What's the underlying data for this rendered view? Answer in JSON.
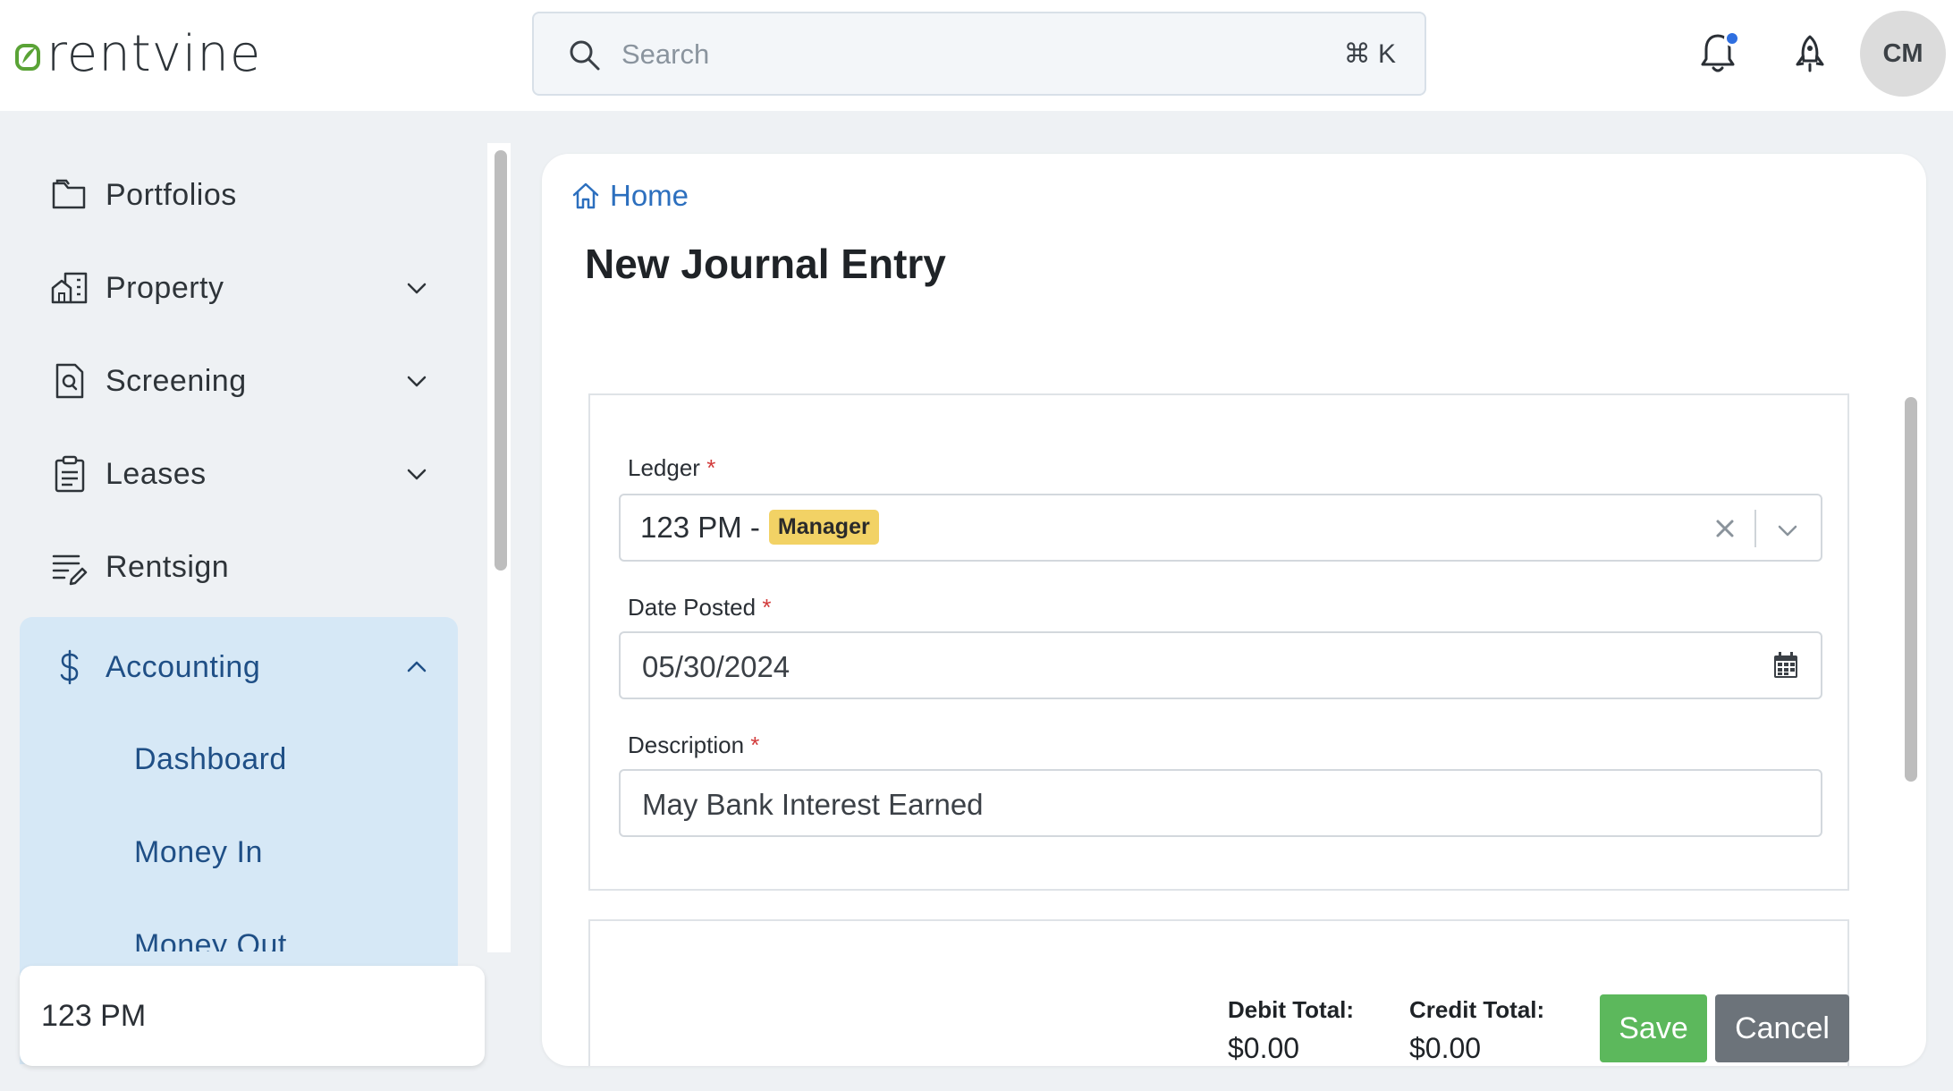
{
  "app": {
    "logo_text": "rentvine",
    "brand_color": "#5aa336"
  },
  "header": {
    "search_placeholder": "Search",
    "search_shortcut": "⌘ K",
    "avatar_initials": "CM",
    "notification_dot_color": "#2f6fe0"
  },
  "sidebar": {
    "items": [
      {
        "label": "Portfolios",
        "icon": "folder-icon",
        "expandable": false
      },
      {
        "label": "Property",
        "icon": "building-icon",
        "expandable": true
      },
      {
        "label": "Screening",
        "icon": "document-search-icon",
        "expandable": true
      },
      {
        "label": "Leases",
        "icon": "clipboard-icon",
        "expandable": true
      },
      {
        "label": "Rentsign",
        "icon": "sign-pen-icon",
        "expandable": false
      },
      {
        "label": "Accounting",
        "icon": "dollar-icon",
        "expandable": true,
        "expanded": true
      }
    ],
    "accounting_sub_items": [
      "Dashboard",
      "Money In",
      "Money Out"
    ],
    "portfolio_selector": "123 PM"
  },
  "main": {
    "breadcrumb": "Home",
    "title": "New Journal Entry",
    "form": {
      "ledger_label": "Ledger",
      "ledger_value": "123 PM -",
      "ledger_badge": "Manager",
      "date_label": "Date Posted",
      "date_value": "05/30/2024",
      "description_label": "Description",
      "description_value": "May Bank Interest Earned",
      "required_marker": "*"
    },
    "totals": {
      "debit_label": "Debit Total:",
      "debit_value": "$0.00",
      "credit_label": "Credit Total:",
      "credit_value": "$0.00"
    },
    "actions": {
      "save": "Save",
      "cancel": "Cancel"
    }
  }
}
